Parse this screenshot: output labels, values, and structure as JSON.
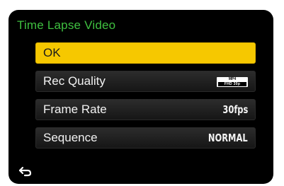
{
  "menu": {
    "title": "Time Lapse Video",
    "items": [
      {
        "label": "OK",
        "value": ""
      },
      {
        "label": "Rec Quality",
        "value": ""
      },
      {
        "label": "Frame Rate",
        "value": "30fps"
      },
      {
        "label": "Sequence",
        "value": "NORMAL"
      }
    ]
  },
  "rec_quality_icon": {
    "top": "MP4",
    "bottom": "FHD 30p"
  },
  "icons": {
    "back": "return-arrow-icon"
  },
  "colors": {
    "title": "#3fc040",
    "selected": "#f6c800",
    "background": "#000000"
  }
}
